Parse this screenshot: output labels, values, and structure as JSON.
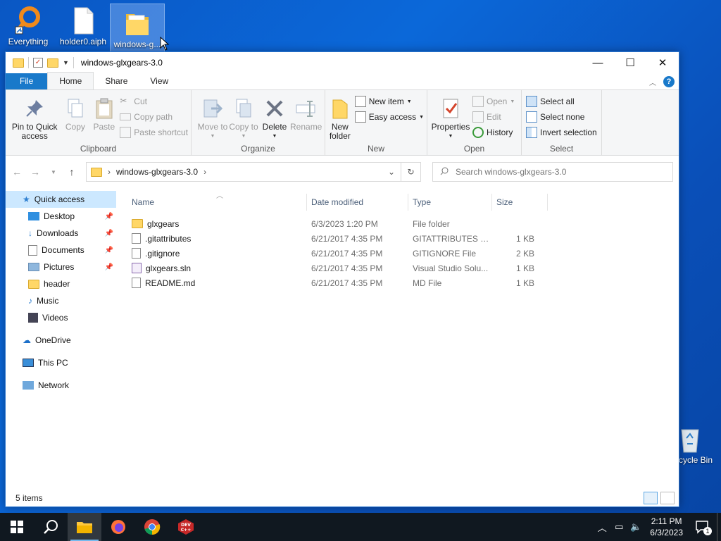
{
  "desktop": {
    "icons": [
      {
        "label": "Everything"
      },
      {
        "label": "holder0.aiph"
      },
      {
        "label": "windows-g..."
      },
      {
        "label": "Recycle Bin"
      }
    ],
    "partial_labels": {
      "recycle": "cycle Bin"
    }
  },
  "window": {
    "title": "windows-glxgears-3.0",
    "controls": {
      "minimize": "—",
      "maximize": "☐",
      "close": "✕"
    }
  },
  "ribbon": {
    "tabs": [
      {
        "label": "File"
      },
      {
        "label": "Home"
      },
      {
        "label": "Share"
      },
      {
        "label": "View"
      }
    ],
    "clipboard": {
      "label": "Clipboard",
      "pin": "Pin to Quick access",
      "copy": "Copy",
      "paste": "Paste",
      "cut": "Cut",
      "copy_path": "Copy path",
      "paste_shortcut": "Paste shortcut"
    },
    "organize": {
      "label": "Organize",
      "move_to": "Move to",
      "copy_to": "Copy to",
      "delete": "Delete",
      "rename": "Rename"
    },
    "new": {
      "label": "New",
      "new_folder": "New folder",
      "new_item": "New item",
      "easy_access": "Easy access"
    },
    "open": {
      "label": "Open",
      "properties": "Properties",
      "open": "Open",
      "edit": "Edit",
      "history": "History"
    },
    "select": {
      "label": "Select",
      "select_all": "Select all",
      "select_none": "Select none",
      "invert_selection": "Invert selection"
    }
  },
  "address": {
    "path": "windows-glxgears-3.0",
    "search_placeholder": "Search windows-glxgears-3.0"
  },
  "navpane": {
    "items": [
      {
        "label": "Quick access"
      },
      {
        "label": "Desktop"
      },
      {
        "label": "Downloads"
      },
      {
        "label": "Documents"
      },
      {
        "label": "Pictures"
      },
      {
        "label": "header"
      },
      {
        "label": "Music"
      },
      {
        "label": "Videos"
      },
      {
        "label": "OneDrive"
      },
      {
        "label": "This PC"
      },
      {
        "label": "Network"
      }
    ]
  },
  "filelist": {
    "columns": [
      "Name",
      "Date modified",
      "Type",
      "Size"
    ],
    "rows": [
      {
        "name": "glxgears",
        "date": "6/3/2023 1:20 PM",
        "type": "File folder",
        "size": ""
      },
      {
        "name": ".gitattributes",
        "date": "6/21/2017 4:35 PM",
        "type": "GITATTRIBUTES File",
        "size": "1 KB"
      },
      {
        "name": ".gitignore",
        "date": "6/21/2017 4:35 PM",
        "type": "GITIGNORE File",
        "size": "2 KB"
      },
      {
        "name": "glxgears.sln",
        "date": "6/21/2017 4:35 PM",
        "type": "Visual Studio Solu...",
        "size": "1 KB"
      },
      {
        "name": "README.md",
        "date": "6/21/2017 4:35 PM",
        "type": "MD File",
        "size": "1 KB"
      }
    ]
  },
  "status": {
    "items_count": "5 items"
  },
  "taskbar": {
    "time": "2:11 PM",
    "date": "6/3/2023",
    "notification_count": "1"
  }
}
